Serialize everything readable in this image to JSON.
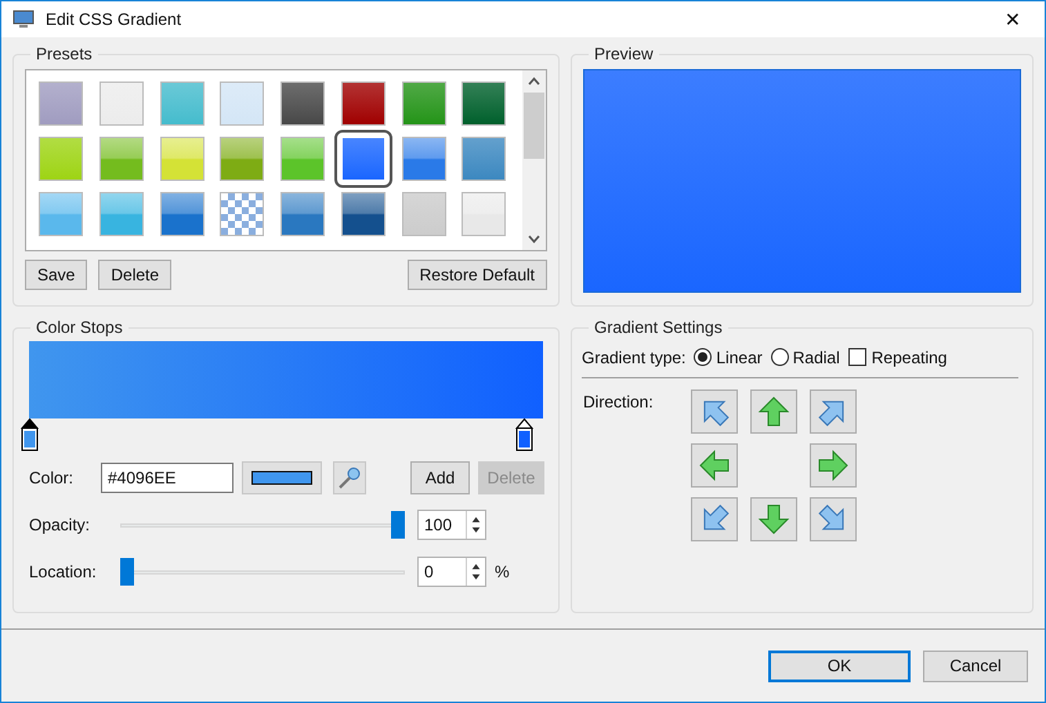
{
  "window": {
    "title": "Edit CSS Gradient",
    "close": "✕"
  },
  "presets": {
    "title": "Presets",
    "swatches": [
      {
        "color": "#a09cc0",
        "kind": "flat",
        "selected": false
      },
      {
        "color": "#ececec",
        "kind": "flat",
        "selected": false
      },
      {
        "color": "#45bccd",
        "kind": "flat",
        "selected": false
      },
      {
        "color": "#d4e6f6",
        "kind": "flat",
        "selected": false
      },
      {
        "color": "#484848",
        "kind": "flat",
        "selected": false
      },
      {
        "color": "#a00000",
        "kind": "flat",
        "selected": false
      },
      {
        "color": "#249418",
        "kind": "flat",
        "selected": false
      },
      {
        "color": "#00602c",
        "kind": "flat",
        "selected": false
      },
      {
        "color": "#9ed414",
        "kind": "flat",
        "selected": false
      },
      {
        "color": "#74bc1e",
        "kind": "gloss",
        "selected": false
      },
      {
        "color": "#d4e236",
        "kind": "gloss",
        "selected": false
      },
      {
        "color": "#7eac14",
        "kind": "gloss",
        "selected": false
      },
      {
        "color": "#5cc42a",
        "kind": "gloss",
        "selected": false
      },
      {
        "color": "#1a66ff",
        "kind": "flat",
        "selected": true
      },
      {
        "color": "#2a7ae8",
        "kind": "gloss",
        "selected": false
      },
      {
        "color": "#3c88c0",
        "kind": "flat",
        "selected": false
      },
      {
        "color": "#5ab8ec",
        "kind": "gloss",
        "selected": false
      },
      {
        "color": "#38b4e0",
        "kind": "gloss",
        "selected": false
      },
      {
        "color": "#1a72cc",
        "kind": "gloss",
        "selected": false
      },
      {
        "color": "#8aaede",
        "kind": "checker",
        "selected": false
      },
      {
        "color": "#2a78c0",
        "kind": "gloss",
        "selected": false
      },
      {
        "color": "#14508e",
        "kind": "gloss",
        "selected": false
      },
      {
        "color": "#cccccc",
        "kind": "flat",
        "selected": false
      },
      {
        "color": "#e8e8e8",
        "kind": "gloss",
        "selected": false
      }
    ],
    "buttons": [
      "Save",
      "Delete"
    ],
    "restore": "Restore Default"
  },
  "preview": {
    "title": "Preview"
  },
  "color_stops": {
    "title": "Color Stops",
    "stops": [
      {
        "color": "#4096ee",
        "level": 0,
        "selected": true
      },
      {
        "color": "#1060ff",
        "level": 1,
        "selected": false
      }
    ],
    "color_label": "Color:",
    "color_value": "#4096EE",
    "add": {
      "label": "Add",
      "disabled": false
    },
    "delete": {
      "label": "Delete",
      "disabled": true
    },
    "opacity": {
      "label": "Opacity:",
      "level": 1,
      "value": "100"
    },
    "location": {
      "label": "Location:",
      "level": 0,
      "value": "0",
      "unit": "%"
    }
  },
  "gradient_settings": {
    "title": "Gradient Settings",
    "type_label": "Gradient type:",
    "types": [
      {
        "label": "Linear",
        "selected": true
      },
      {
        "label": "Radial",
        "selected": false
      }
    ],
    "repeating": {
      "label": "Repeating",
      "checked": false
    },
    "direction_label": "Direction:",
    "directions": [
      {
        "kind": "nw"
      },
      {
        "kind": "n"
      },
      {
        "kind": "ne"
      },
      {
        "kind": "w"
      },
      {
        "kind": "none"
      },
      {
        "kind": "e"
      },
      {
        "kind": "sw"
      },
      {
        "kind": "s"
      },
      {
        "kind": "se"
      }
    ]
  },
  "buttons": [
    {
      "label": "OK",
      "default": true
    },
    {
      "label": "Cancel",
      "default": false
    }
  ]
}
